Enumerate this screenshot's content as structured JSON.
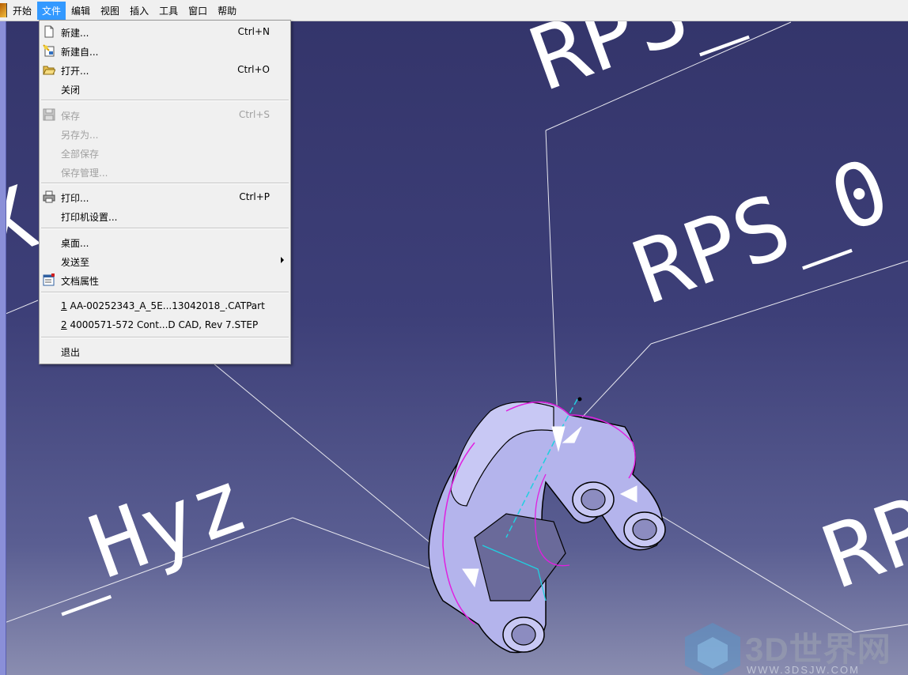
{
  "menubar": {
    "items": [
      {
        "label": "开始"
      },
      {
        "label": "文件",
        "active": true
      },
      {
        "label": "编辑"
      },
      {
        "label": "视图"
      },
      {
        "label": "插入"
      },
      {
        "label": "工具"
      },
      {
        "label": "窗口"
      },
      {
        "label": "帮助"
      }
    ]
  },
  "file_menu": {
    "new": {
      "label": "新建...",
      "shortcut": "Ctrl+N",
      "icon": "new-document-icon"
    },
    "new_from": {
      "label": "新建自...",
      "icon": "new-from-icon"
    },
    "open": {
      "label": "打开...",
      "shortcut": "Ctrl+O",
      "icon": "open-folder-icon"
    },
    "close": {
      "label": "关闭"
    },
    "save": {
      "label": "保存",
      "shortcut": "Ctrl+S",
      "icon": "save-disk-icon",
      "disabled": true
    },
    "save_as": {
      "label": "另存为...",
      "disabled": true
    },
    "save_all": {
      "label": "全部保存",
      "disabled": true
    },
    "save_management": {
      "label": "保存管理...",
      "disabled": true
    },
    "print": {
      "label": "打印...",
      "shortcut": "Ctrl+P",
      "icon": "printer-icon"
    },
    "printer_setup": {
      "label": "打印机设置..."
    },
    "desk": {
      "label": "桌面..."
    },
    "send_to": {
      "label": "发送至",
      "icon": "submenu-arrow-icon"
    },
    "doc_properties": {
      "label": "文档属性",
      "icon": "properties-icon"
    },
    "recent_files": [
      {
        "num": "1",
        "label": " AA-00252343_A_5E...13042018_.CATPart"
      },
      {
        "num": "2",
        "label": " 4000571-572 Cont...D CAD, Rev 7.STEP"
      }
    ],
    "exit": {
      "label": "退出"
    }
  },
  "viewport": {
    "background_top": "#34356b",
    "background_bottom": "#8a8db0",
    "annotation_texts": [
      "RPS_",
      "RPS_0",
      "_Hyz",
      "RP",
      "X"
    ]
  },
  "watermark": {
    "title": "3D世界网",
    "url": "WWW.3DSJW.COM"
  },
  "colors": {
    "menu_highlight": "#3399ff",
    "part_fill": "#b4b4ec",
    "curve_magenta": "#e020e0",
    "curve_cyan": "#20d0e0"
  }
}
